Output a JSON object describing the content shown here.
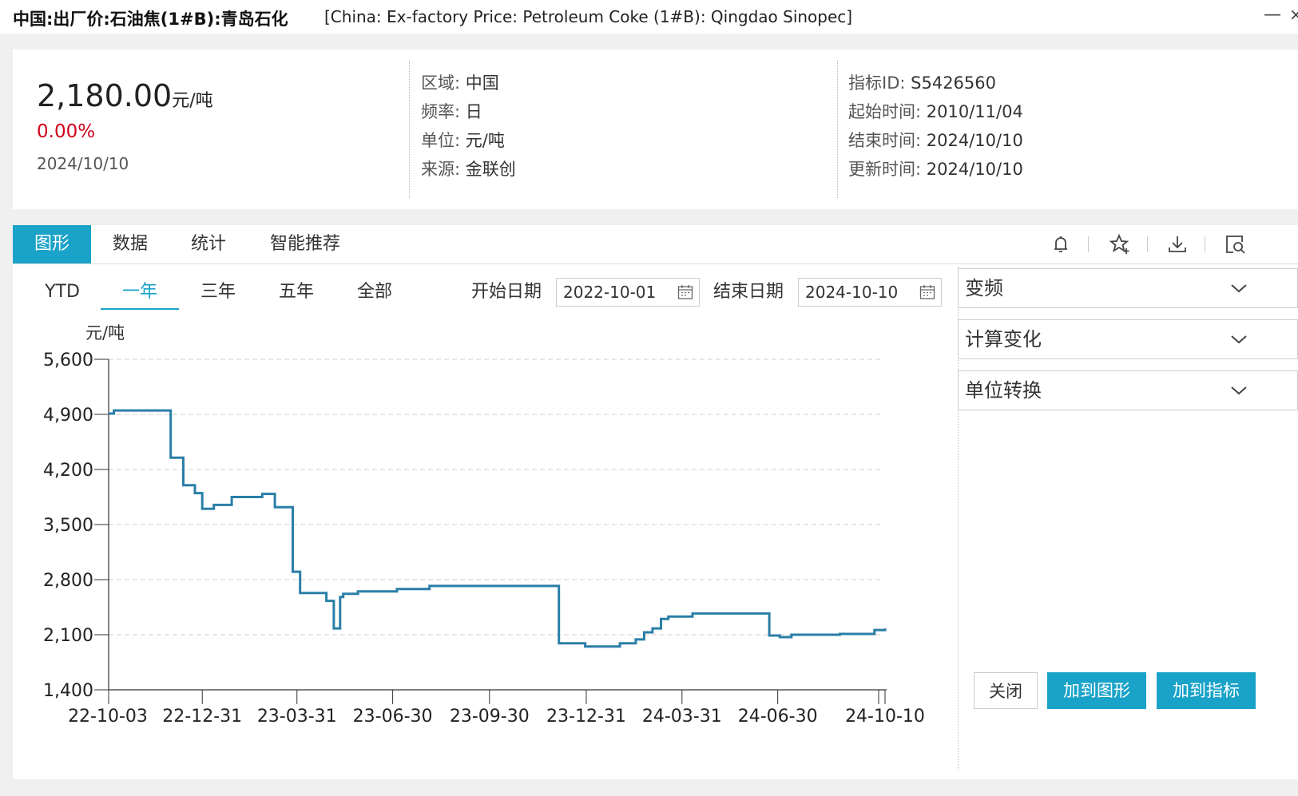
{
  "window": {
    "title_cn": "中国:出厂价:石油焦(1#B):青岛石化",
    "title_en": "[China: Ex-factory Price: Petroleum Coke (1#B): Qingdao Sinopec]",
    "minimize": "—",
    "close": "×"
  },
  "summary": {
    "value": "2,180.00",
    "unit": "元/吨",
    "change": "0.00%",
    "date": "2024/10/10",
    "change_color": "#d0021b"
  },
  "meta_left": [
    {
      "key": "区域",
      "value": "中国"
    },
    {
      "key": "频率",
      "value": "日"
    },
    {
      "key": "单位",
      "value": "元/吨"
    },
    {
      "key": "来源",
      "value": "金联创"
    }
  ],
  "meta_right": [
    {
      "key": "指标ID",
      "value": "S5426560"
    },
    {
      "key": "起始时间",
      "value": "2010/11/04"
    },
    {
      "key": "结束时间",
      "value": "2024/10/10"
    },
    {
      "key": "更新时间",
      "value": "2024/10/10"
    }
  ],
  "tabs": [
    "图形",
    "数据",
    "统计",
    "智能推荐"
  ],
  "toolbar_icons": [
    "bell-icon",
    "star-add-icon",
    "download-icon",
    "search-doc-icon"
  ],
  "ranges": [
    "YTD",
    "一年",
    "三年",
    "五年",
    "全部"
  ],
  "date_filter": {
    "start_label": "开始日期",
    "start_value": "2022-10-01",
    "end_label": "结束日期",
    "end_value": "2024-10-10"
  },
  "side_dropdowns": [
    "变频",
    "计算变化",
    "单位转换"
  ],
  "buttons": {
    "close": "关闭",
    "add_chart": "加到图形",
    "add_indicator": "加到指标"
  },
  "accent_color": "#1aa3c9",
  "line_color": "#2a7fa7",
  "chart_data": {
    "type": "line",
    "ylabel": "元/吨",
    "ylim": [
      1400,
      5600
    ],
    "yticks": [
      1400,
      2100,
      2800,
      3500,
      4200,
      4900,
      5600
    ],
    "ytick_labels": [
      "1,400",
      "2,100",
      "2,800",
      "3,500",
      "4,200",
      "4,900",
      "5,600"
    ],
    "xlim": [
      "2022-10-03",
      "2024-10-10"
    ],
    "xticks": [
      "2022-10-03",
      "2022-12-31",
      "2023-03-31",
      "2023-06-30",
      "2023-09-30",
      "2023-12-31",
      "2024-03-31",
      "2024-06-30",
      "2024-10-10"
    ],
    "xtick_labels": [
      "22-10-03",
      "22-12-31",
      "23-03-31",
      "23-06-30",
      "23-09-30",
      "23-12-31",
      "24-03-31",
      "24-06-30",
      "24-10-10"
    ],
    "grid": true,
    "step": true,
    "series": [
      {
        "x": [
          "2022-10-03",
          "2022-10-08",
          "2022-12-01",
          "2022-12-13",
          "2022-12-24",
          "2022-12-31",
          "2023-01-11",
          "2023-01-28",
          "2023-02-01",
          "2023-02-26",
          "2023-03-10",
          "2023-03-27",
          "2023-04-03",
          "2023-04-28",
          "2023-05-05",
          "2023-05-11",
          "2023-05-14",
          "2023-05-28",
          "2023-07-04",
          "2023-08-04",
          "2023-12-05",
          "2023-12-30",
          "2024-01-02",
          "2024-02-01",
          "2024-02-16",
          "2024-02-24",
          "2024-03-03",
          "2024-03-11",
          "2024-03-18",
          "2024-04-10",
          "2024-06-22",
          "2024-07-02",
          "2024-07-13",
          "2024-08-28",
          "2024-09-30",
          "2024-10-10"
        ],
        "y": [
          4910,
          4950,
          4350,
          4000,
          3900,
          3700,
          3750,
          3850,
          3850,
          3890,
          3720,
          2900,
          2630,
          2530,
          2180,
          2580,
          2620,
          2650,
          2680,
          2720,
          1990,
          1950,
          1950,
          1990,
          2040,
          2130,
          2180,
          2300,
          2330,
          2370,
          2090,
          2070,
          2100,
          2110,
          2160,
          2180
        ]
      }
    ]
  }
}
